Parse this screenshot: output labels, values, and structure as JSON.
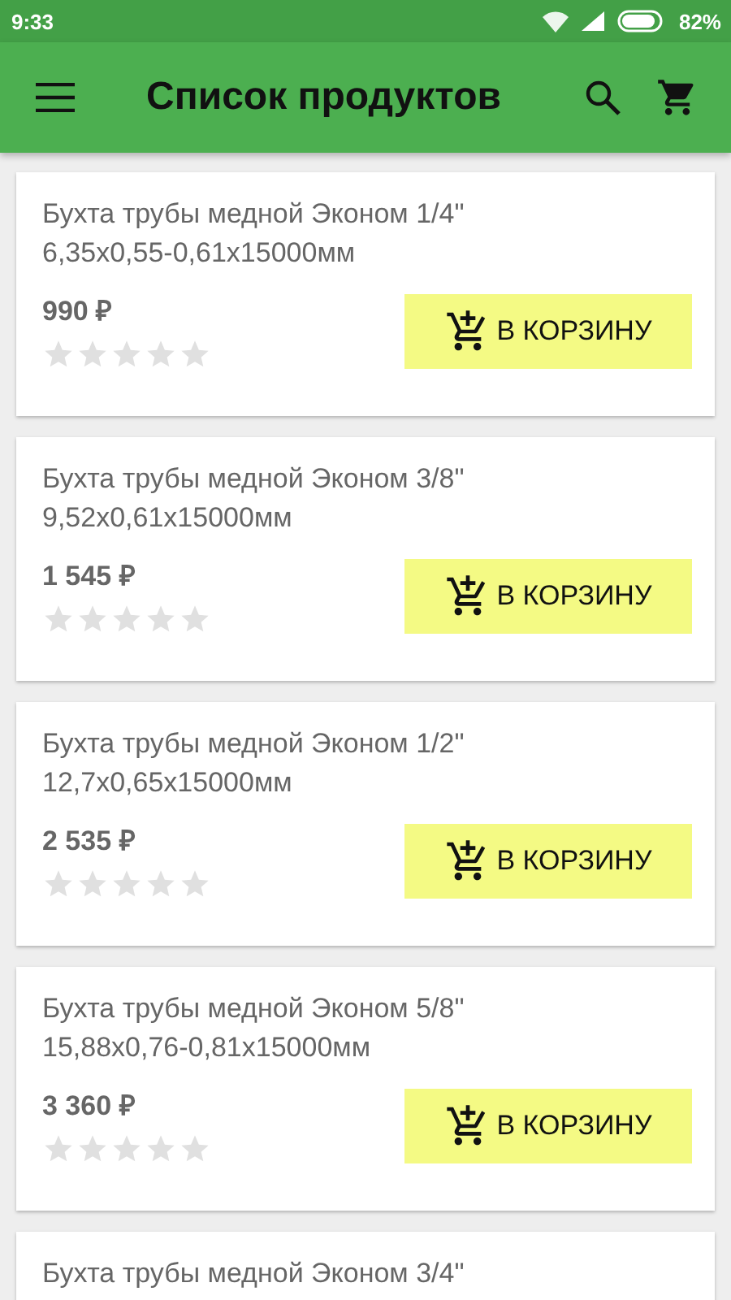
{
  "status_bar": {
    "time": "9:33",
    "battery": "82%"
  },
  "app_bar": {
    "title": "Список продуктов"
  },
  "products": [
    {
      "name": "Бухта трубы медной Эконом 1/4\"",
      "size": "6,35x0,55-0,61x15000мм",
      "price": "990 ₽",
      "stars": 0,
      "button": "В КОРЗИНУ"
    },
    {
      "name": "Бухта трубы медной Эконом 3/8\"",
      "size": "9,52x0,61x15000мм",
      "price": "1 545 ₽",
      "stars": 0,
      "button": "В КОРЗИНУ"
    },
    {
      "name": "Бухта трубы медной Эконом 1/2\"",
      "size": "12,7x0,65x15000мм",
      "price": "2 535 ₽",
      "stars": 0,
      "button": "В КОРЗИНУ"
    },
    {
      "name": "Бухта трубы медной Эконом 5/8\"",
      "size": "15,88x0,76-0,81x15000мм",
      "price": "3 360 ₽",
      "stars": 0,
      "button": "В КОРЗИНУ"
    },
    {
      "name": "Бухта трубы медной Эконом 3/4\""
    }
  ]
}
